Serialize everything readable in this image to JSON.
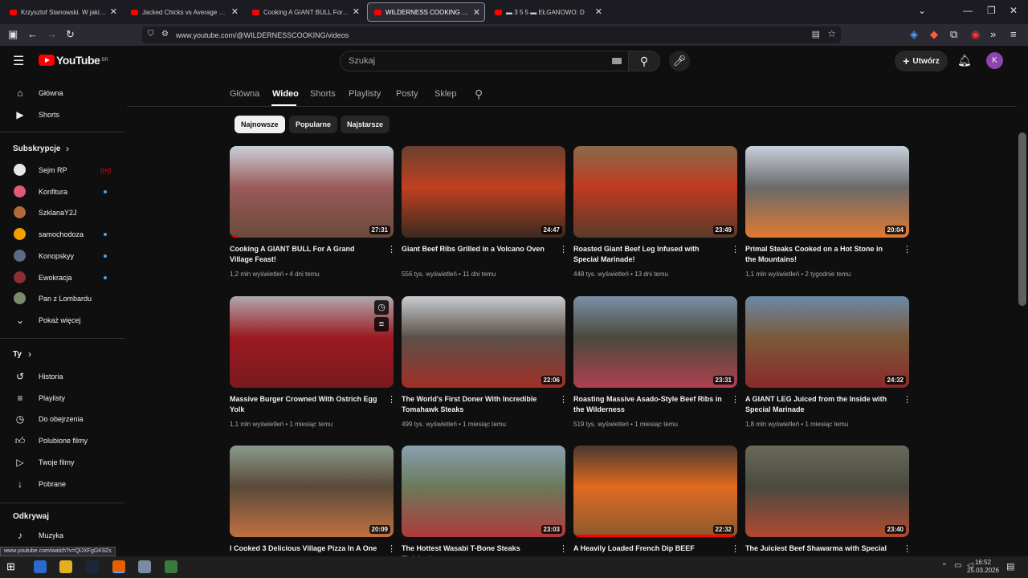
{
  "browser": {
    "tabs": [
      {
        "title": "Krzysztof Stanowski. W jakiej sy"
      },
      {
        "title": "Jacked Chicks vs Average Joes |"
      },
      {
        "title": "Cooking A GIANT BULL For A G"
      },
      {
        "title": "WILDERNESS COOKING - YouTu"
      },
      {
        "title": "▬ 3 5 5 ▬ EŁGANOWO: D"
      }
    ],
    "url": "www.youtube.com/@WILDERNESSCOOKING/videos"
  },
  "yt": {
    "logo_text": "YouTube",
    "region": "BR",
    "search_placeholder": "Szukaj",
    "create_label": "Utwórz",
    "avatar_letter": "K"
  },
  "sidebar": {
    "main": [
      {
        "label": "Główna",
        "icon": "home-icon"
      },
      {
        "label": "Shorts",
        "icon": "shorts-icon"
      }
    ],
    "subs_heading": "Subskrypcje",
    "subs": [
      {
        "label": "Sejm RP",
        "color": "#e8e8e8",
        "live": true
      },
      {
        "label": "Konfitura",
        "color": "#e05a7a",
        "dot": true
      },
      {
        "label": "SzklanaY2J",
        "color": "#b06a3a",
        "dot": false
      },
      {
        "label": "samochodoza",
        "color": "#f0a000",
        "dot": true
      },
      {
        "label": "Konopskyy",
        "color": "#5a6a8a",
        "dot": true
      },
      {
        "label": "Ewokracja",
        "color": "#8a3030",
        "dot": true
      },
      {
        "label": "Pan z Lombardu",
        "color": "#7a8a6a",
        "dot": false
      }
    ],
    "show_more": "Pokaż więcej",
    "you_heading": "Ty",
    "you": [
      {
        "label": "Historia",
        "icon": "history-icon"
      },
      {
        "label": "Playlisty",
        "icon": "playlists-icon"
      },
      {
        "label": "Do obejrzenia",
        "icon": "watch-later-icon"
      },
      {
        "label": "Polubione filmy",
        "icon": "liked-icon"
      },
      {
        "label": "Twoje filmy",
        "icon": "your-videos-icon"
      },
      {
        "label": "Pobrane",
        "icon": "downloads-icon"
      }
    ],
    "explore_heading": "Odkrywaj",
    "explore": [
      {
        "label": "Muzyka",
        "icon": "music-icon"
      }
    ]
  },
  "status_url": "www.youtube.com/watch?v=QlJXFgGK9Zs",
  "channel_tabs": [
    "Główna",
    "Wideo",
    "Shorts",
    "Playlisty",
    "Posty",
    "Sklep"
  ],
  "chips": [
    "Najnowsze",
    "Popularne",
    "Najstarsze"
  ],
  "videos": [
    {
      "title": "Cooking A GIANT BULL For A Grand Village Feast!",
      "views": "1,2 mln wyświetleń",
      "age": "4 dni temu",
      "duration": "27:31",
      "colors": [
        "#c8d0d8",
        "#9a5a5a",
        "#6a4a3a"
      ],
      "watched": 0.05
    },
    {
      "title": "Giant Beef Ribs Grilled in a Volcano Oven",
      "views": "556 tys. wyświetleń",
      "age": "11 dni temu",
      "duration": "24:47",
      "colors": [
        "#6a4030",
        "#c04020",
        "#3a2a20"
      ]
    },
    {
      "title": "Roasted Giant Beef Leg Infused with Special Marinade!",
      "views": "448 tys. wyświetleń",
      "age": "13 dni temu",
      "duration": "23:49",
      "colors": [
        "#8a6a4a",
        "#c03a20",
        "#5a3a2a"
      ]
    },
    {
      "title": "Primal Steaks Cooked on a Hot Stone in the Mountains!",
      "views": "1,1 mln wyświetleń",
      "age": "2 tygodnie temu",
      "duration": "20:04",
      "colors": [
        "#c8d0dc",
        "#6a6a6a",
        "#e07a30"
      ]
    },
    {
      "title": "Massive Burger Crowned With Ostrich Egg Yolk",
      "views": "1,1 mln wyświetleń",
      "age": "1 miesiąc temu",
      "duration": "",
      "colors": [
        "#b0a8b0",
        "#9a1a20",
        "#7a1a20"
      ],
      "hover": true
    },
    {
      "title": "The World's First Doner With Incredible Tomahawk Steaks",
      "views": "499 tys. wyświetleń",
      "age": "1 miesiąc temu",
      "duration": "22:06",
      "colors": [
        "#c8ccd0",
        "#5a5048",
        "#a03028"
      ]
    },
    {
      "title": "Roasting Massive Asado-Style Beef Ribs in the Wilderness",
      "views": "519 tys. wyświetleń",
      "age": "1 miesiąc temu",
      "duration": "23:31",
      "colors": [
        "#7a90a8",
        "#4a4a3a",
        "#b04050"
      ]
    },
    {
      "title": "A GIANT LEG Juiced from the Inside with Special Marinade",
      "views": "1,8 mln wyświetleń",
      "age": "1 miesiąc temu",
      "duration": "24:32",
      "colors": [
        "#6a8aa8",
        "#7a5a3a",
        "#8a2a2a"
      ]
    },
    {
      "title": "I Cooked 3 Delicious Village Pizza In A One",
      "views": "",
      "age": "",
      "duration": "20:09",
      "colors": [
        "#8a9a8a",
        "#5a4a3a",
        "#c07040"
      ]
    },
    {
      "title": "The Hottest Wasabi T-Bone Steaks Finished",
      "views": "",
      "age": "",
      "duration": "23:03",
      "colors": [
        "#8aa0b0",
        "#6a7a5a",
        "#b03a3a"
      ]
    },
    {
      "title": "A Heavily Loaded French Dip BEEF",
      "views": "",
      "age": "",
      "duration": "22:32",
      "colors": [
        "#4a3a30",
        "#e06a20",
        "#8a5a30"
      ],
      "watched": 1.0
    },
    {
      "title": "The Juiciest Beef Shawarma with Special",
      "views": "",
      "age": "",
      "duration": "23:40",
      "colors": [
        "#6a6a5a",
        "#4a4a40",
        "#b04a30"
      ]
    }
  ],
  "taskbar": {
    "time": "16:52",
    "date": "25.03.2026"
  }
}
